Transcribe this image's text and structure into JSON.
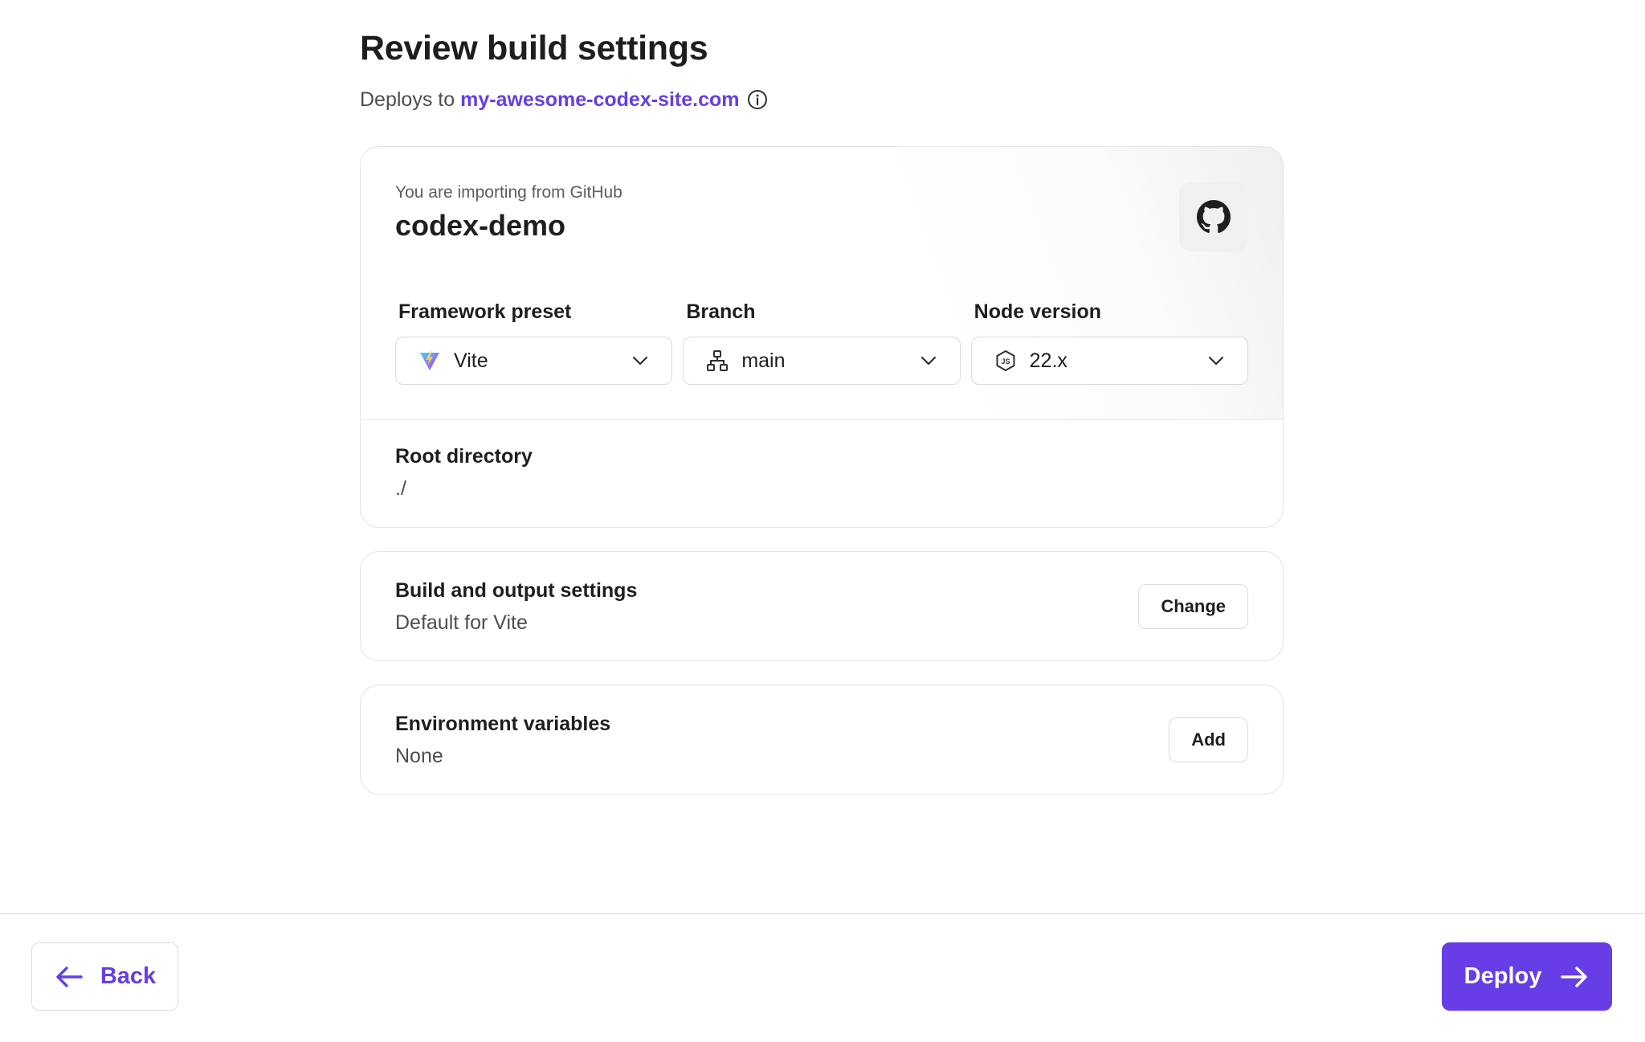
{
  "header": {
    "title": "Review build settings",
    "deploys_to_label": "Deploys to",
    "domain": "my-awesome-codex-site.com"
  },
  "import": {
    "caption": "You are importing from GitHub",
    "repo_name": "codex-demo",
    "provider_icon": "github-icon"
  },
  "fields": {
    "framework": {
      "label": "Framework preset",
      "value": "Vite",
      "icon": "vite-icon"
    },
    "branch": {
      "label": "Branch",
      "value": "main",
      "icon": "branch-icon"
    },
    "node": {
      "label": "Node version",
      "value": "22.x",
      "icon": "nodejs-icon"
    }
  },
  "root_directory": {
    "label": "Root directory",
    "value": "./"
  },
  "build_settings": {
    "title": "Build and output settings",
    "value": "Default for Vite",
    "button": "Change"
  },
  "env_vars": {
    "title": "Environment variables",
    "value": "None",
    "button": "Add"
  },
  "footer": {
    "back_label": "Back",
    "deploy_label": "Deploy"
  },
  "colors": {
    "accent": "#673de6",
    "text": "#1d1e20",
    "muted": "#4b4d52",
    "border": "#e3e4e8"
  }
}
